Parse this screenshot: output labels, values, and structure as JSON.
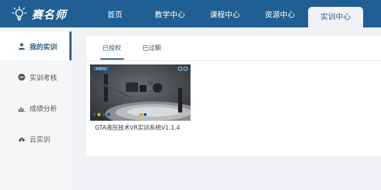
{
  "brand": {
    "name": "赛名师"
  },
  "nav": {
    "items": [
      {
        "label": "首页"
      },
      {
        "label": "教学中心"
      },
      {
        "label": "课程中心"
      },
      {
        "label": "资源中心"
      },
      {
        "label": "实训中心",
        "active": true
      }
    ]
  },
  "sidebar": {
    "items": [
      {
        "label": "我的实训",
        "icon": "user-icon",
        "active": true
      },
      {
        "label": "实训考核",
        "icon": "circle-minus-icon"
      },
      {
        "label": "成绩分析",
        "icon": "bar-chart-icon"
      },
      {
        "label": "云实训",
        "icon": "cloud-icon"
      }
    ]
  },
  "tabs": [
    {
      "label": "已授权",
      "active": true
    },
    {
      "label": "已过期"
    }
  ],
  "courses": [
    {
      "title": "GTA液压技术VR实训系统V1.1.4",
      "thumbnail_label": "宏观实训"
    }
  ],
  "colors": {
    "primary": "#1f5f93",
    "background": "#f0f2f5"
  }
}
